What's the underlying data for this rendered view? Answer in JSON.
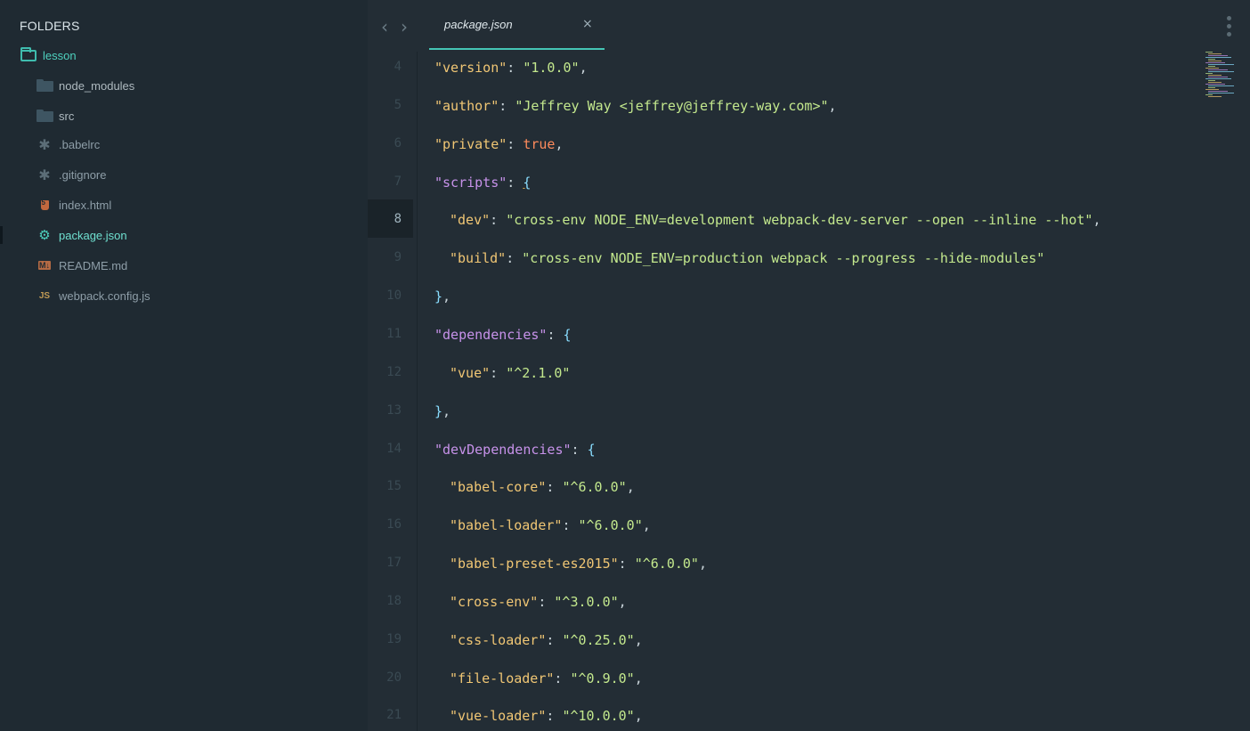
{
  "sidebar": {
    "title": "FOLDERS",
    "items": [
      {
        "label": "lesson"
      },
      {
        "label": "node_modules"
      },
      {
        "label": "src"
      },
      {
        "label": ".babelrc"
      },
      {
        "label": ".gitignore"
      },
      {
        "label": "index.html"
      },
      {
        "label": "package.json"
      },
      {
        "label": "README.md"
      },
      {
        "label": "webpack.config.js"
      }
    ]
  },
  "tabs": [
    {
      "label": "package.json",
      "close": "×"
    }
  ],
  "editor": {
    "current_line": "8",
    "line_numbers": [
      "4",
      "5",
      "6",
      "7",
      "8",
      "9",
      "10",
      "11",
      "12",
      "13",
      "14",
      "15",
      "16",
      "17",
      "18",
      "19",
      "20",
      "21"
    ],
    "lines": [
      {
        "key": "\"version\"",
        "colon": ": ",
        "value": "\"1.0.0\"",
        "tail": ","
      },
      {
        "key": "\"author\"",
        "colon": ": ",
        "value": "\"Jeffrey Way <jeffrey@jeffrey-way.com>\"",
        "tail": ","
      },
      {
        "key": "\"private\"",
        "colon": ": ",
        "value": "true",
        "tail": ","
      },
      {
        "key": "\"scripts\"",
        "colon": ": ",
        "value": "{",
        "tail": ""
      },
      {
        "key": "\"dev\"",
        "colon": ": ",
        "value": "\"cross-env NODE_ENV=development webpack-dev-server --open --inline --hot\"",
        "tail": ","
      },
      {
        "key": "\"build\"",
        "colon": ": ",
        "value": "\"cross-env NODE_ENV=production webpack --progress --hide-modules\"",
        "tail": ""
      },
      {
        "key": "}",
        "colon": "",
        "value": "",
        "tail": ","
      },
      {
        "key": "\"dependencies\"",
        "colon": ": ",
        "value": "{",
        "tail": ""
      },
      {
        "key": "\"vue\"",
        "colon": ": ",
        "value": "\"^2.1.0\"",
        "tail": ""
      },
      {
        "key": "}",
        "colon": "",
        "value": "",
        "tail": ","
      },
      {
        "key": "\"devDependencies\"",
        "colon": ": ",
        "value": "{",
        "tail": ""
      },
      {
        "key": "\"babel-core\"",
        "colon": ": ",
        "value": "\"^6.0.0\"",
        "tail": ","
      },
      {
        "key": "\"babel-loader\"",
        "colon": ": ",
        "value": "\"^6.0.0\"",
        "tail": ","
      },
      {
        "key": "\"babel-preset-es2015\"",
        "colon": ": ",
        "value": "\"^6.0.0\"",
        "tail": ","
      },
      {
        "key": "\"cross-env\"",
        "colon": ": ",
        "value": "\"^3.0.0\"",
        "tail": ","
      },
      {
        "key": "\"css-loader\"",
        "colon": ": ",
        "value": "\"^0.25.0\"",
        "tail": ","
      },
      {
        "key": "\"file-loader\"",
        "colon": ": ",
        "value": "\"^0.9.0\"",
        "tail": ","
      },
      {
        "key": "\"vue-loader\"",
        "colon": ": ",
        "value": "\"^10.0.0\"",
        "tail": ","
      }
    ]
  },
  "colors": {
    "background": "#232d35",
    "sidebar": "#1f2a32",
    "accent": "#45c6b5",
    "key": "#f0c674",
    "parent_key": "#c792ea",
    "string": "#c3e88d",
    "boolean": "#ff8b5c"
  }
}
